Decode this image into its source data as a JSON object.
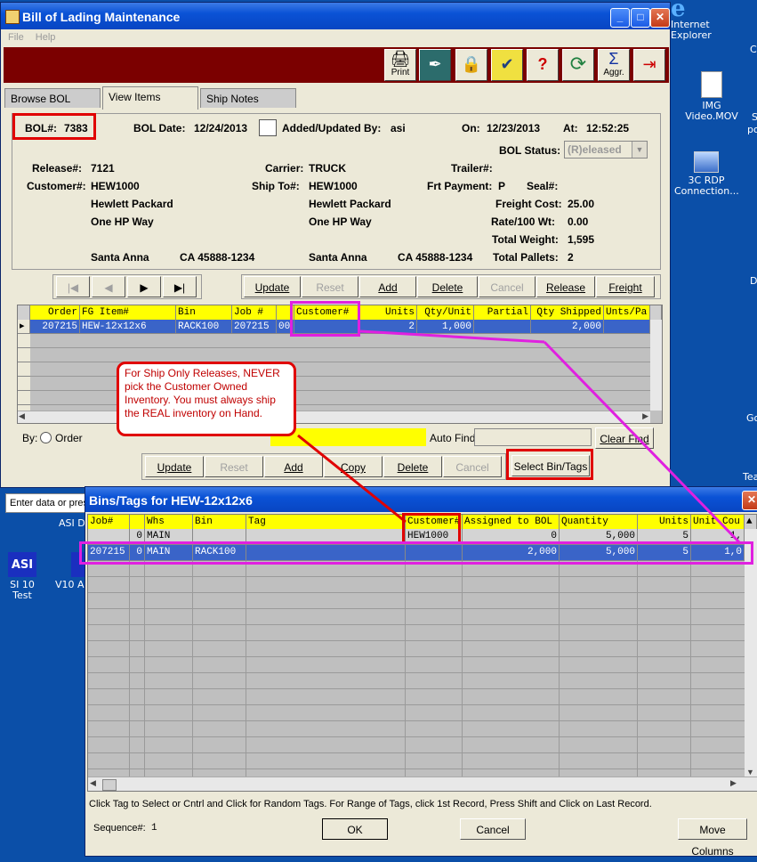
{
  "desktop": {
    "icons": [
      {
        "label": "Internet\nExplorer"
      },
      {
        "label": "IMG\nVideo.MOV"
      },
      {
        "label": "3C RDP\nConnection..."
      },
      {
        "label": "SI 10 Test"
      },
      {
        "label": "V10 A"
      }
    ],
    "edge_fragments": [
      "C",
      "S",
      "po",
      "D",
      "Go",
      "Tea"
    ],
    "asi_label": "ASI",
    "asi_d": "ASI D",
    "enter_data": "Enter data or pres"
  },
  "bol_window": {
    "title": "Bill of Lading Maintenance",
    "menu": [
      "File",
      "Help"
    ],
    "toolbar": [
      {
        "icon": "printer-icon",
        "label": "Print",
        "glyph": "🖨"
      },
      {
        "icon": "pen-icon",
        "label": "",
        "glyph": "✒"
      },
      {
        "icon": "lock-icon",
        "label": "",
        "glyph": "🔒"
      },
      {
        "icon": "checklist-icon",
        "label": "",
        "glyph": "✔"
      },
      {
        "icon": "help-icon",
        "label": "",
        "glyph": "?"
      },
      {
        "icon": "refresh-icon",
        "label": "",
        "glyph": "⟳"
      },
      {
        "icon": "sigma-icon",
        "label": "Aggr.",
        "glyph": "Σ"
      },
      {
        "icon": "exit-icon",
        "label": "",
        "glyph": "⇥"
      }
    ],
    "tabs": [
      "Browse BOL",
      "View Items",
      "Ship Notes"
    ],
    "header": {
      "bol_label": "BOL#:",
      "bol_value": "7383",
      "bol_date_label": "BOL Date:",
      "bol_date": "12/24/2013",
      "added_label": "Added/Updated By:",
      "added_value": "asi",
      "on_label": "On:",
      "on_value": "12/23/2013",
      "at_label": "At:",
      "at_value": "12:52:25",
      "status_label": "BOL Status:",
      "status_value": "(R)eleased",
      "release_label": "Release#:",
      "release_value": "7121",
      "carrier_label": "Carrier:",
      "carrier_value": "TRUCK",
      "trailer_label": "Trailer#:",
      "customer_label": "Customer#:",
      "customer_value": "HEW1000",
      "shipto_label": "Ship To#:",
      "shipto_value": "HEW1000",
      "frt_label": "Frt Payment:",
      "frt_value": "P",
      "seal_label": "Seal#:",
      "cust_name": "Hewlett Packard",
      "cust_addr": "One HP Way",
      "cust_city": "Santa Anna",
      "cust_state_zip": "CA 45888-1234",
      "ship_name": "Hewlett Packard",
      "ship_addr": "One HP Way",
      "ship_city": "Santa Anna",
      "ship_state_zip": "CA 45888-1234",
      "freight_label": "Freight Cost:",
      "freight_value": "25.00",
      "rate_label": "Rate/100 Wt:",
      "rate_value": "0.00",
      "weight_label": "Total Weight:",
      "weight_value": "1,595",
      "pallets_label": "Total Pallets:",
      "pallets_value": "2"
    },
    "nav_buttons": [
      "|◀",
      "◀",
      "▶",
      "▶|"
    ],
    "action_buttons": [
      "Update",
      "Reset",
      "Add",
      "Delete",
      "Cancel",
      "Release",
      "Freight"
    ],
    "items_grid": {
      "headers": [
        "Order",
        "FG Item#",
        "Bin",
        "Job #",
        "Customer#",
        "Units",
        "Qty/Unit",
        "Partial",
        "Qty Shipped",
        "Unts/Pa"
      ],
      "rows": [
        [
          "207215",
          "HEW-12x12x6",
          "RACK100",
          "207215",
          "00",
          "",
          "2",
          "1,000",
          "",
          "2,000"
        ]
      ]
    },
    "by_label": "By:",
    "by_option": "Order",
    "auto_find_label": "Auto Find:",
    "clear_find": "Clear Find",
    "bottom_buttons": [
      "Update",
      "Reset",
      "Add",
      "Copy",
      "Delete",
      "Cancel"
    ],
    "select_bin_tags": "Select Bin/Tags",
    "annotation": "For Ship Only Releases, NEVER pick the Customer Owned Inventory.  You must always ship the REAL inventory on Hand."
  },
  "bins_window": {
    "title": "Bins/Tags for HEW-12x12x6",
    "headers": [
      "Job#",
      "",
      "Whs",
      "Bin",
      "Tag",
      "Customer#",
      "Assigned to BOL",
      "Quantity",
      "Units",
      "Unit Cou"
    ],
    "rows": [
      [
        "",
        "0",
        "MAIN",
        "",
        "",
        "HEW1000",
        "0",
        "5,000",
        "5",
        "1,"
      ],
      [
        "207215",
        "0",
        "MAIN",
        "RACK100",
        "",
        "",
        "2,000",
        "5,000",
        "5",
        "1,0"
      ]
    ],
    "hint": "Click Tag to Select or Cntrl and Click for Random Tags. For Range of Tags, click 1st Record, Press Shift and Click on Last Record.",
    "sequence_label": "Sequence#:",
    "sequence_value": "1",
    "ok": "OK",
    "cancel": "Cancel",
    "move_columns": "Move Columns"
  }
}
